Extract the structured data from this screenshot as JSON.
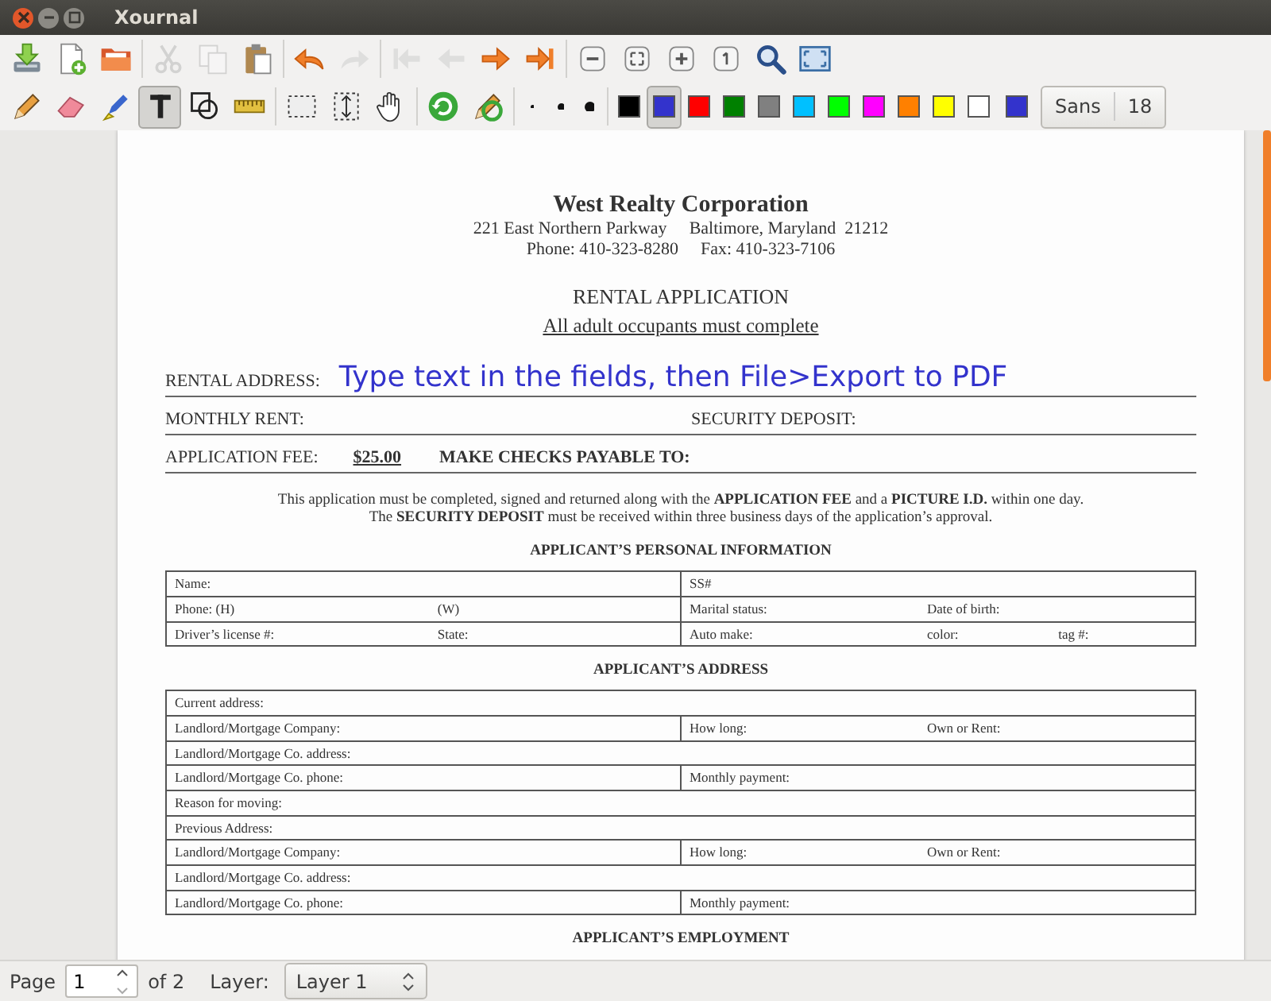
{
  "window": {
    "title": "Xournal"
  },
  "toolbars": [
    {
      "items": [
        {
          "kind": "tool",
          "disabled": false
        },
        {
          "kind": "tool",
          "disabled": false
        },
        {
          "kind": "tool",
          "disabled": false
        },
        {
          "kind": "separator"
        },
        {
          "kind": "tool",
          "disabled": true
        },
        {
          "kind": "tool",
          "disabled": true
        },
        {
          "kind": "tool",
          "disabled": false
        },
        {
          "kind": "separator"
        },
        {
          "kind": "tool",
          "disabled": false
        },
        {
          "kind": "tool",
          "disabled": true
        },
        {
          "kind": "separator"
        },
        {
          "kind": "tool",
          "disabled": true
        },
        {
          "kind": "tool",
          "disabled": true
        },
        {
          "kind": "tool",
          "disabled": false
        },
        {
          "kind": "tool",
          "disabled": false
        },
        {
          "kind": "separator"
        },
        {
          "kind": "tool",
          "disabled": false
        },
        {
          "kind": "tool",
          "disabled": false
        },
        {
          "kind": "tool",
          "disabled": false
        },
        {
          "kind": "tool",
          "disabled": false
        },
        {
          "kind": "tool",
          "disabled": false
        },
        {
          "kind": "tool",
          "disabled": false
        }
      ]
    },
    {
      "items": [
        {
          "kind": "tool",
          "selected": false
        },
        {
          "kind": "tool",
          "selected": false
        },
        {
          "kind": "tool",
          "selected": false
        },
        {
          "kind": "tool",
          "selected": true
        },
        {
          "kind": "tool",
          "selected": false
        },
        {
          "kind": "tool",
          "selected": false
        },
        {
          "kind": "separator"
        },
        {
          "kind": "tool",
          "selected": false
        },
        {
          "kind": "tool",
          "selected": false
        },
        {
          "kind": "tool",
          "selected": false
        },
        {
          "kind": "separator"
        },
        {
          "kind": "tool",
          "selected": false
        },
        {
          "kind": "tool",
          "selected": false
        },
        {
          "kind": "separator"
        },
        {
          "kind": "size"
        },
        {
          "kind": "size"
        },
        {
          "kind": "size"
        },
        {
          "kind": "separator"
        },
        {
          "kind": "swatch",
          "color": "#000000",
          "selected": false
        },
        {
          "kind": "swatch",
          "color": "#3333cc",
          "selected": true
        },
        {
          "kind": "swatch",
          "color": "#ff0000",
          "selected": false
        },
        {
          "kind": "swatch",
          "color": "#008000",
          "selected": false
        },
        {
          "kind": "swatch",
          "color": "#808080",
          "selected": false
        },
        {
          "kind": "swatch",
          "color": "#00c0ff",
          "selected": false
        },
        {
          "kind": "swatch",
          "color": "#00ff00",
          "selected": false
        },
        {
          "kind": "swatch",
          "color": "#ff00ff",
          "selected": false
        },
        {
          "kind": "swatch",
          "color": "#ff8000",
          "selected": false
        },
        {
          "kind": "swatch",
          "color": "#ffff00",
          "selected": false
        },
        {
          "kind": "swatch",
          "color": "#ffffff",
          "selected": false
        },
        {
          "kind": "current",
          "color": "#3333cc"
        },
        {
          "kind": "font",
          "font": "Sans",
          "size": "18"
        }
      ]
    }
  ],
  "document": {
    "company": "West Realty Corporation",
    "address_lines": [
      "221 East Northern Parkway",
      "Baltimore, Maryland  21212"
    ],
    "phone_lines": [
      "Phone: 410-323-8280",
      "Fax: 410-323-7106"
    ],
    "form_title": "RENTAL APPLICATION",
    "form_subtitle": "All adult occupants must complete",
    "form_lines": [
      {
        "items": [
          {
            "kind": "label",
            "text": "RENTAL ADDRESS:"
          },
          {
            "kind": "typed",
            "text": "Type text in the fields, then File>Export to PDF"
          }
        ]
      },
      {
        "items": [
          {
            "kind": "label",
            "text": "MONTHLY RENT:"
          },
          {
            "kind": "right_label",
            "text": "SECURITY DEPOSIT:"
          }
        ]
      },
      {
        "items": [
          {
            "kind": "label",
            "text": "APPLICATION FEE:"
          },
          {
            "kind": "amount",
            "text": "$25.00"
          },
          {
            "kind": "emphasis",
            "text": "MAKE CHECKS PAYABLE TO:"
          }
        ]
      }
    ],
    "notice_lines": [
      "This application must be completed, signed and returned along with the **APPLICATION FEE** and a **PICTURE I.D.** within one day.",
      "The **SECURITY DEPOSIT** must be received within three business days of the application’s approval."
    ],
    "sections": [
      {
        "heading": "APPLICANT’S PERSONAL INFORMATION",
        "rows": [
          {
            "cells": [
              {
                "labels": [
                  "Name:"
                ]
              },
              {
                "labels": [
                  "SS#"
                ]
              }
            ]
          },
          {
            "cells": [
              {
                "labels": [
                  "Phone: (H)",
                  "(W)"
                ]
              },
              {
                "labels": [
                  "Marital status:",
                  "Date of birth:"
                ]
              }
            ]
          },
          {
            "cells": [
              {
                "labels": [
                  "Driver’s license #:",
                  "State:"
                ]
              },
              {
                "labels": [
                  "Auto make:",
                  "color:",
                  "tag #:"
                ]
              }
            ]
          }
        ]
      },
      {
        "heading": "APPLICANT’S ADDRESS",
        "rows": [
          {
            "cells": [
              {
                "labels": [
                  "Current address:"
                ],
                "colspan": 2
              }
            ]
          },
          {
            "cells": [
              {
                "labels": [
                  "Landlord/Mortgage Company:"
                ]
              },
              {
                "labels": [
                  "How long:",
                  "Own or Rent:"
                ]
              }
            ]
          },
          {
            "cells": [
              {
                "labels": [
                  "Landlord/Mortgage Co. address:"
                ],
                "colspan": 2
              }
            ]
          },
          {
            "cells": [
              {
                "labels": [
                  "Landlord/Mortgage Co. phone:"
                ]
              },
              {
                "labels": [
                  "Monthly payment:"
                ]
              }
            ]
          },
          {
            "cells": [
              {
                "labels": [
                  "Reason for moving:"
                ],
                "colspan": 2
              }
            ]
          },
          {
            "cells": [
              {
                "labels": [
                  "Previous Address:"
                ],
                "colspan": 2
              }
            ]
          },
          {
            "cells": [
              {
                "labels": [
                  "Landlord/Mortgage Company:"
                ]
              },
              {
                "labels": [
                  "How long:",
                  "Own or Rent:"
                ]
              }
            ]
          },
          {
            "cells": [
              {
                "labels": [
                  "Landlord/Mortgage Co. address:"
                ],
                "colspan": 2
              }
            ]
          },
          {
            "cells": [
              {
                "labels": [
                  "Landlord/Mortgage Co. phone:"
                ]
              },
              {
                "labels": [
                  "Monthly payment:"
                ]
              }
            ]
          }
        ]
      },
      {
        "heading": "APPLICANT’S EMPLOYMENT"
      }
    ]
  },
  "status_bar": {
    "page_label": "Page",
    "page_value": "1",
    "page_total": "of 2",
    "layer_label": "Layer:",
    "layer_value": "Layer 1"
  }
}
